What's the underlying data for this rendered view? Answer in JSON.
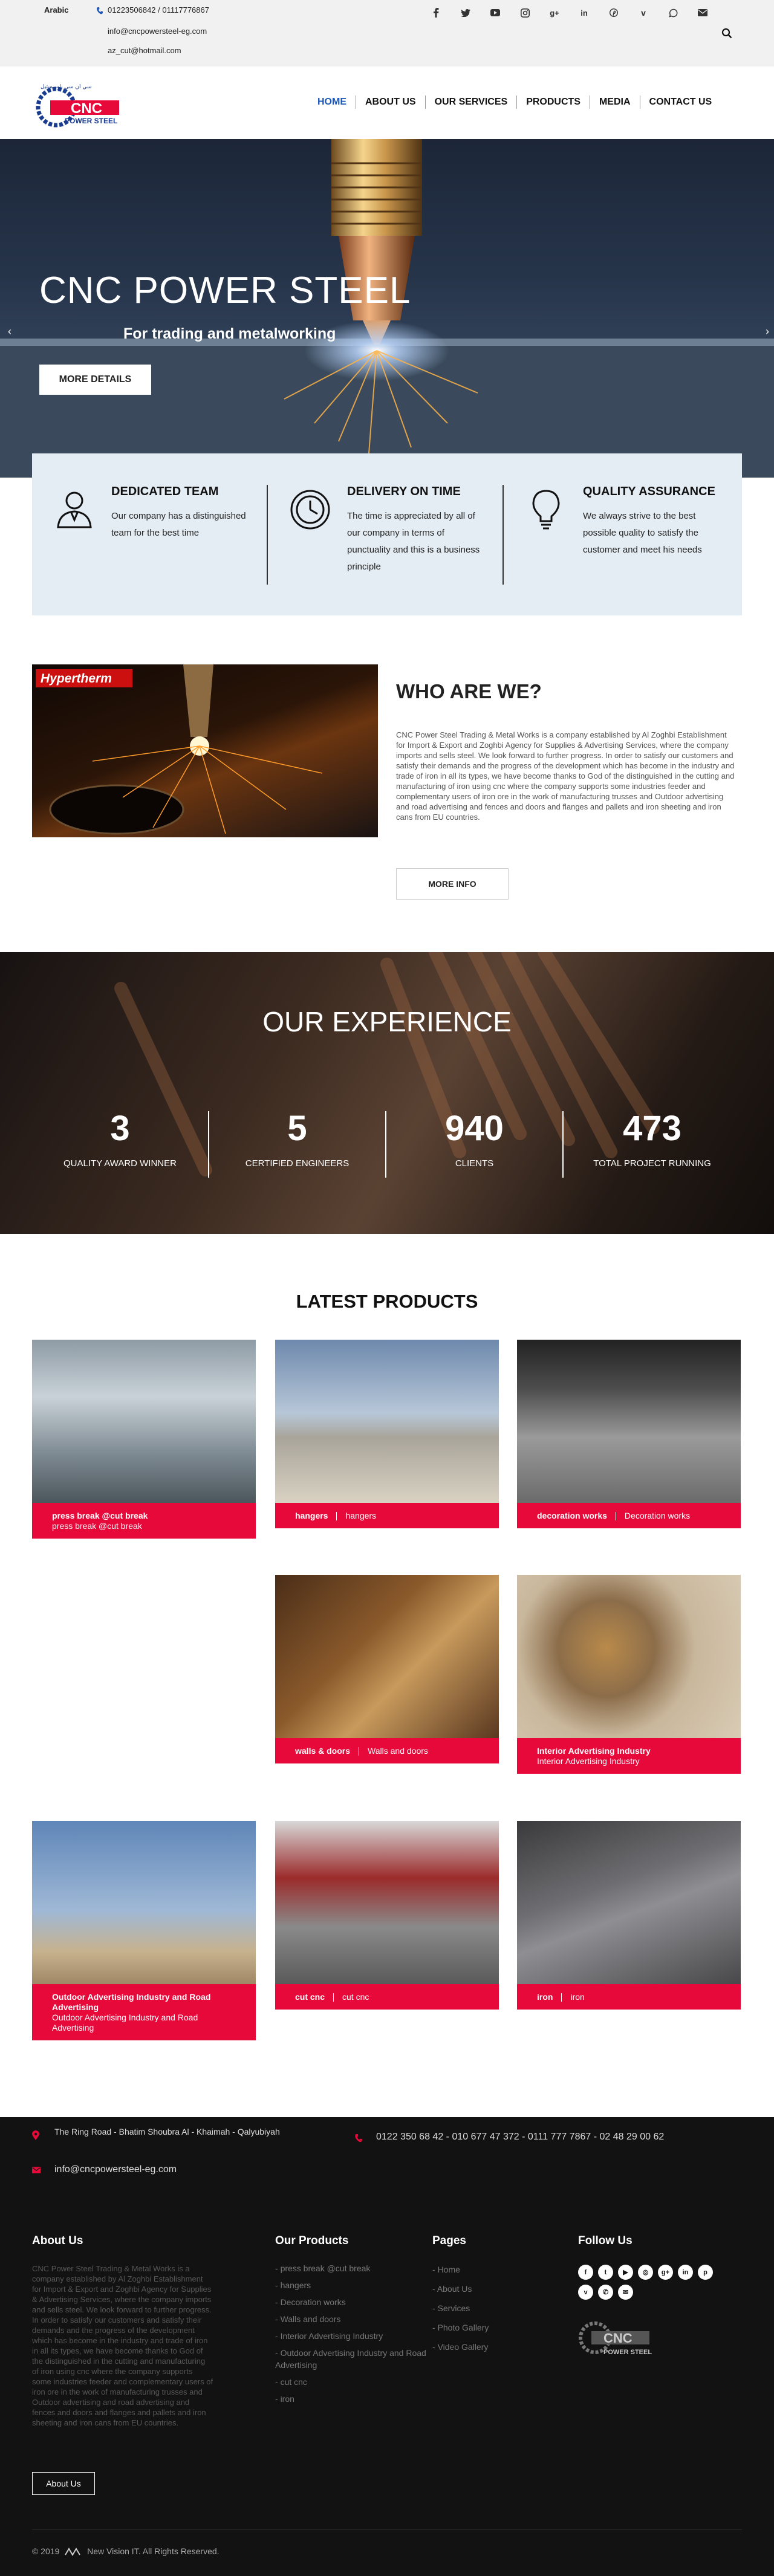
{
  "topbar": {
    "language": "Arabic",
    "phones": "01223506842 / 01117776867",
    "email": "info@cncpowersteel-eg.com",
    "email2": "az_cut@hotmail.com",
    "socials": [
      "facebook-icon",
      "twitter-icon",
      "youtube-icon",
      "instagram-icon",
      "google-plus-icon",
      "linkedin-icon",
      "pinterest-icon",
      "vimeo-icon",
      "whatsapp-icon",
      "mail-icon"
    ]
  },
  "logo": {
    "brand": "CNC",
    "sub": "POWER STEEL",
    "arabic": "سي ان سي باور ستيل"
  },
  "nav": [
    "HOME",
    "ABOUT US",
    "OUR SERVICES",
    "PRODUCTS",
    "MEDIA",
    "CONTACT US"
  ],
  "hero": {
    "title": "CNC POWER STEEL",
    "subtitle": "For trading and metalworking",
    "button": "MORE DETAILS"
  },
  "features": [
    {
      "title": "DEDICATED TEAM",
      "text": "Our company has a distinguished team for the best time"
    },
    {
      "title": "DELIVERY ON TIME",
      "text": "The time is appreciated by all of our company in terms of punctuality and this is a business principle"
    },
    {
      "title": "QUALITY ASSURANCE",
      "text": "We always strive to the best possible quality to satisfy the customer and meet his needs"
    }
  ],
  "who": {
    "image_label": "Hypertherm",
    "title": "WHO ARE WE?",
    "text": "CNC Power Steel Trading & Metal Works is a company established by Al Zoghbi Establishment for Import & Export and Zoghbi Agency for Supplies & Advertising Services, where the company imports and sells steel. We look forward to further progress. In order to satisfy our customers and satisfy their demands and the progress of the development which has become in the industry and trade of iron in all its types, we have become thanks to God of the distinguished in the cutting and manufacturing of iron using cnc where the company supports some industries feeder and complementary users of iron ore in the work of manufacturing trusses and Outdoor advertising and road advertising and fences and doors and flanges and pallets and iron sheeting and iron cans from EU countries.",
    "button": "MORE INFO"
  },
  "experience": {
    "title": "OUR EXPERIENCE",
    "counters": [
      {
        "value": "3",
        "label": "QUALITY AWARD WINNER"
      },
      {
        "value": "5",
        "label": "CERTIFIED ENGINEERS"
      },
      {
        "value": "940",
        "label": "CLIENTS"
      },
      {
        "value": "473",
        "label": "TOTAL PROJECT RUNNING"
      }
    ]
  },
  "products": {
    "title": "LATEST PRODUCTS",
    "items": [
      {
        "title": "press break @cut break",
        "sub": "press break @cut break",
        "inline": false
      },
      {
        "title": "hangers",
        "sub": "hangers",
        "inline": true
      },
      {
        "title": "decoration works",
        "sub": "Decoration works",
        "inline": true
      },
      {
        "title": "walls & doors",
        "sub": "Walls and doors",
        "inline": true
      },
      {
        "title": "Interior Advertising Industry",
        "sub": "Interior Advertising Industry",
        "inline": false
      },
      {
        "title": "Outdoor Advertising Industry and Road Advertising",
        "sub": "Outdoor Advertising Industry and Road Advertising",
        "inline": false
      },
      {
        "title": "cut cnc",
        "sub": "cut cnc",
        "inline": true
      },
      {
        "title": "iron",
        "sub": "iron",
        "inline": true
      }
    ]
  },
  "footer": {
    "address": "The Ring Road - Bhatim Shoubra Al - Khaimah - Qalyubiyah",
    "phones": "0122 350 68 42 - 010 677 47 372 - 0111 777 7867 - 02 48 29 00 62",
    "email": "info@cncpowersteel-eg.com",
    "about_title": "About Us",
    "about_text": "CNC Power Steel Trading & Metal Works is a company established by Al Zoghbi Establishment for Import & Export and Zoghbi Agency for Supplies & Advertising Services, where the company imports and sells steel. We look forward to further progress. In order to satisfy our customers and satisfy their demands and the progress of the development which has become in the industry and trade of iron in all its types, we have become thanks to God of the distinguished in the cutting and manufacturing of iron using cnc where the company supports some industries feeder and complementary users of iron ore in the work of manufacturing trusses and Outdoor advertising and road advertising and fences and doors and flanges and pallets and iron sheeting and iron cans from EU countries.",
    "about_button": "About Us",
    "products_title": "Our Products",
    "products_list": [
      "press break @cut break",
      "hangers",
      "Decoration works",
      "Walls and doors",
      "Interior Advertising Industry",
      "Outdoor Advertising Industry and Road Advertising",
      "cut cnc",
      "iron"
    ],
    "pages_title": "Pages",
    "pages_list": [
      "Home",
      "About Us",
      "Services",
      "Photo Gallery",
      "Video Gallery"
    ],
    "follow_title": "Follow Us",
    "copyright": "© 2019",
    "copyright_brand": "New Vision IT. All Rights Reserved."
  }
}
